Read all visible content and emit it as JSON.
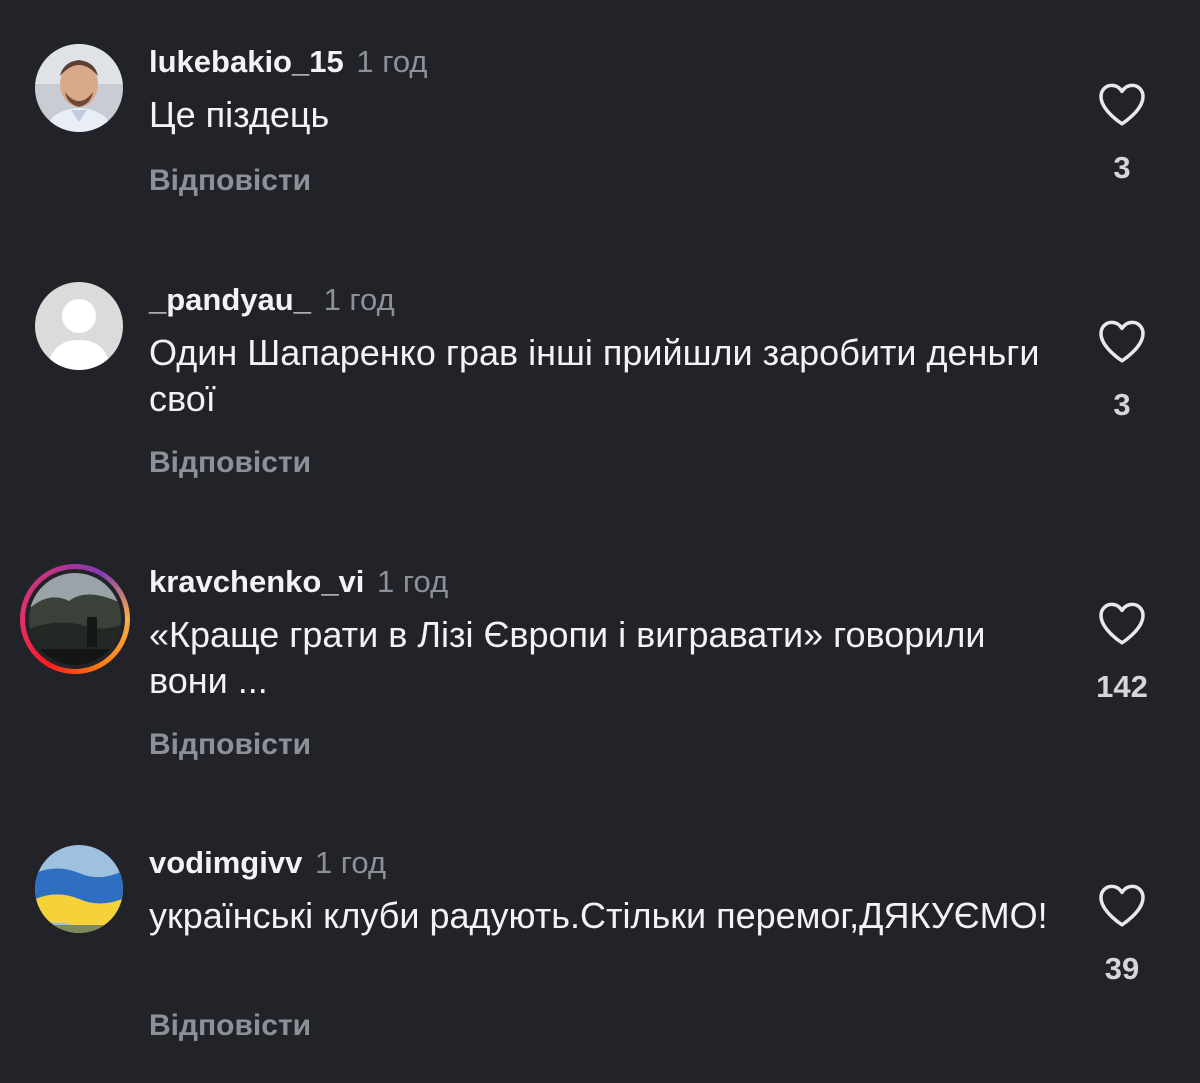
{
  "comments": [
    {
      "username": "lukebakio_15",
      "time": "1 год",
      "text": "Це піздець",
      "reply_label": "Відповісти",
      "likes": "3",
      "avatar": "photo-man"
    },
    {
      "username": "_pandyau_",
      "time": "1 год",
      "text": "Один Шапаренко грав інші прийшли заробити деньги свої",
      "reply_label": "Відповісти",
      "likes": "3",
      "avatar": "default-user"
    },
    {
      "username": "kravchenko_vi",
      "time": "1 год",
      "text": "«Краще грати в Лізі Європи і вигравати» говорили вони ...",
      "reply_label": "Відповісти",
      "likes": "142",
      "avatar": "photo-landscape-with-story-ring"
    },
    {
      "username": "vodimgivv",
      "time": "1 год",
      "text": "українські клуби радують.Стільки перемог,ДЯКУЄМО!",
      "reply_label": "Відповісти",
      "likes": "39",
      "avatar": "ukraine-flag"
    }
  ],
  "icons": {
    "like": "heart-outline-icon"
  },
  "colors": {
    "background": "#222329",
    "primary_text": "#f2f3f5",
    "secondary_text": "#8e9099",
    "flag_blue": "#2f6fc2",
    "flag_yellow": "#f5d23a"
  }
}
